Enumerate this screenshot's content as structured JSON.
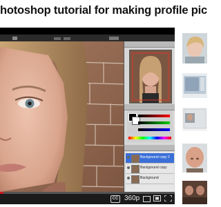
{
  "page": {
    "title": "hotoshop tutorial for making profile pictures better"
  },
  "player": {
    "quality_label": "360p",
    "cc_label": "CC",
    "progress_fraction": 0.02
  },
  "photoshop": {
    "layers": [
      {
        "name": "Background copy 2",
        "selected": true
      },
      {
        "name": "Background copy",
        "selected": false
      },
      {
        "name": "Background",
        "selected": false
      }
    ]
  },
  "sidebar": {
    "thumbnails": [
      {
        "icon": "child-portrait-thumbnail"
      },
      {
        "icon": "screen-recording-thumbnail"
      },
      {
        "icon": "window-screenshot-thumbnail"
      },
      {
        "icon": "bald-head-thumbnail"
      },
      {
        "icon": "people-photo-thumbnail"
      }
    ]
  },
  "colors": {
    "progress": "#cc181e",
    "player_bg": "#000000",
    "layer_selected": "#3b6fd8"
  }
}
